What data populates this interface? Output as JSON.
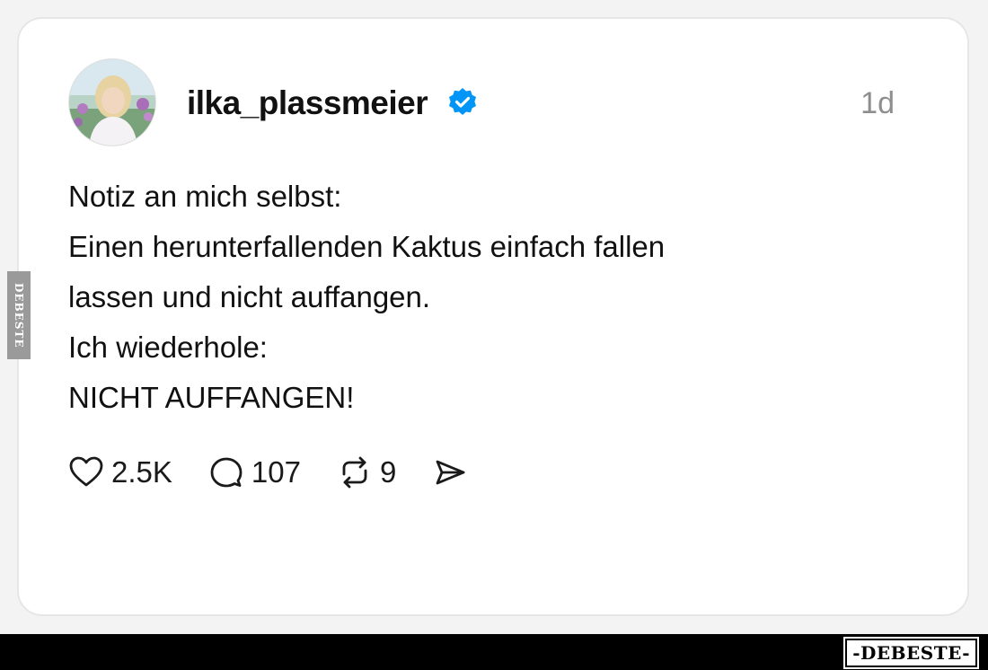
{
  "post": {
    "username": "ilka_plassmeier",
    "verified": true,
    "timestamp": "1d",
    "lines": [
      "Notiz an mich selbst:",
      "Einen herunterfallenden Kaktus einfach fallen",
      "lassen und nicht auffangen.",
      "Ich wiederhole:",
      "NICHT AUFFANGEN!"
    ]
  },
  "actions": {
    "like_count": "2.5K",
    "comment_count": "107",
    "repost_count": "9"
  },
  "icons": {
    "avatar": "profile-photo",
    "verified": "verified-badge-icon",
    "like": "heart-icon",
    "comment": "comment-bubble-icon",
    "repost": "repost-icon",
    "share": "send-icon"
  },
  "colors": {
    "verified_blue": "#0095f6",
    "text": "#111111",
    "muted": "#8e8e8e"
  },
  "watermark": {
    "side": "DEBESTE",
    "brand": "-DEBESTE-"
  }
}
